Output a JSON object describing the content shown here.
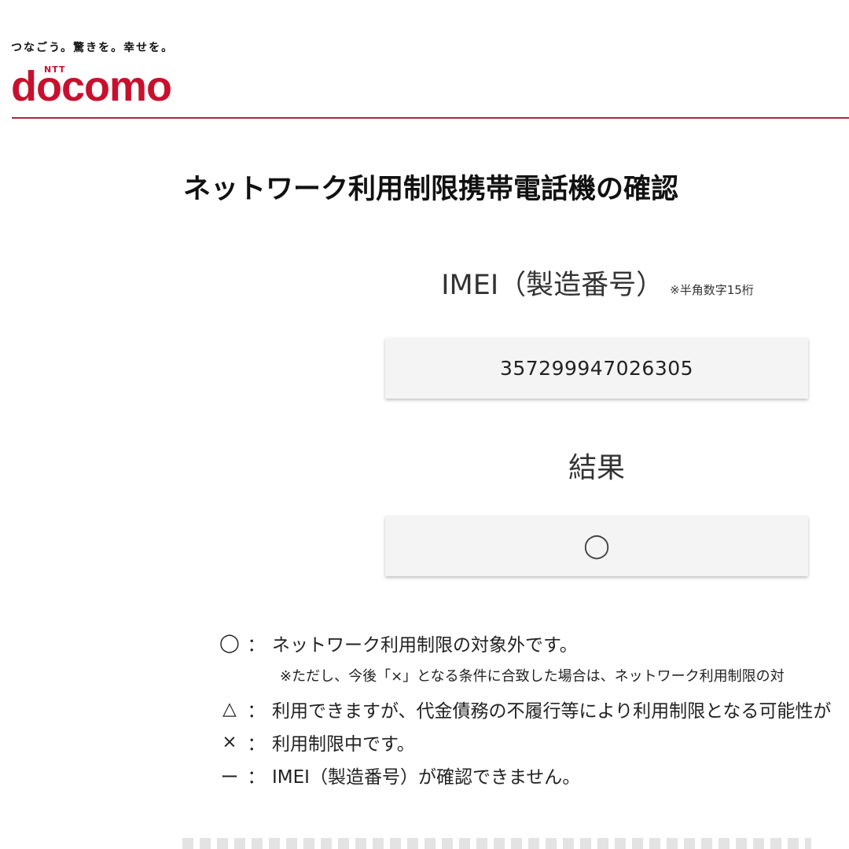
{
  "header": {
    "tagline": "つなごう。驚きを。幸せを。",
    "logo_ntt": "NTT",
    "logo_word": "docomo",
    "brand_color": "#c8102e"
  },
  "main": {
    "title": "ネットワーク利用制限携帯電話機の確認",
    "imei_label": "IMEI（製造番号）",
    "imei_note": "※半角数字15桁",
    "imei_value": "357299947026305",
    "result_label": "結果",
    "result_value": "◯"
  },
  "legend": {
    "items": [
      {
        "symbol": "◯",
        "colon": "：",
        "text": "ネットワーク利用制限の対象外です。"
      },
      {
        "symbol": "△",
        "colon": "：",
        "text": "利用できますが、代金債務の不履行等により利用制限となる可能性が"
      },
      {
        "symbol": "×",
        "colon": "：",
        "text": "利用制限中です。"
      },
      {
        "symbol": "ー",
        "colon": "：",
        "text": "IMEI（製造番号）が確認できません。"
      }
    ],
    "note": "※ただし、今後「×」となる条件に合致した場合は、ネットワーク利用制限の対"
  }
}
